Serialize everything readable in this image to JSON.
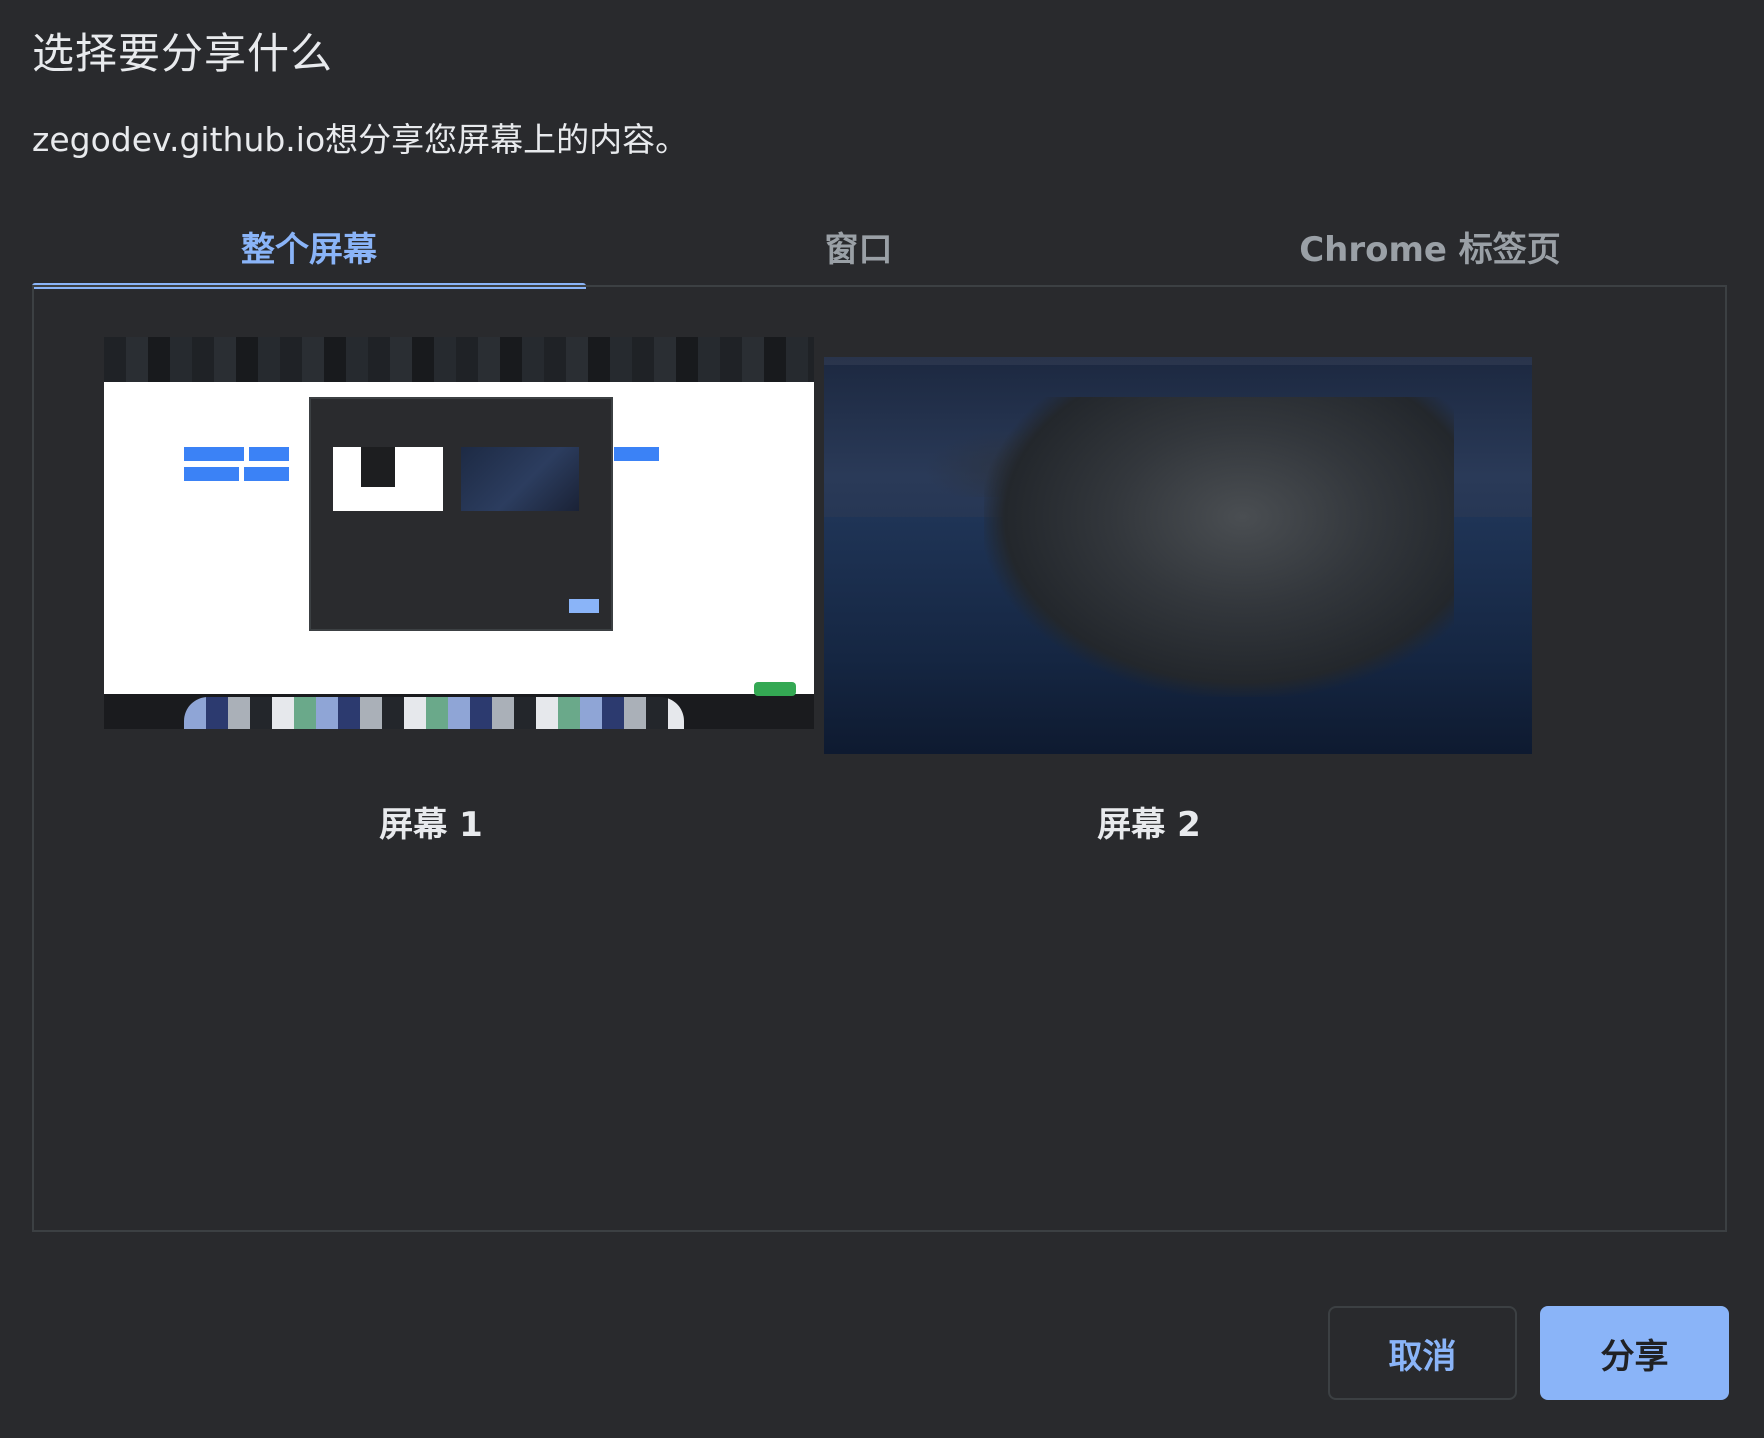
{
  "dialog": {
    "title": "选择要分享什么",
    "subtitle": "zegodev.github.io想分享您屏幕上的内容。"
  },
  "tabs": [
    {
      "label": "整个屏幕",
      "selected": true
    },
    {
      "label": "窗口",
      "selected": false
    },
    {
      "label": "Chrome 标签页",
      "selected": false
    }
  ],
  "sources": [
    {
      "label": "屏幕 1"
    },
    {
      "label": "屏幕 2"
    }
  ],
  "footer": {
    "cancel_label": "取消",
    "share_label": "分享"
  },
  "colors": {
    "background": "#292a2d",
    "accent": "#8ab4f8",
    "text": "#e8eaed",
    "muted": "#9aa0a6",
    "border": "#3c4043"
  }
}
